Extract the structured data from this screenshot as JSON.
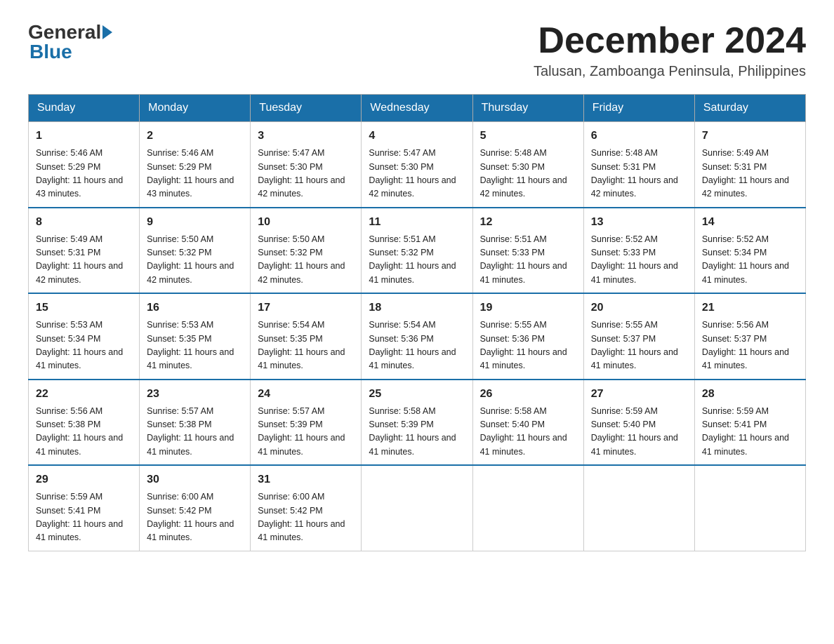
{
  "header": {
    "logo_general": "General",
    "logo_blue": "Blue",
    "month_title": "December 2024",
    "subtitle": "Talusan, Zamboanga Peninsula, Philippines"
  },
  "weekdays": [
    "Sunday",
    "Monday",
    "Tuesday",
    "Wednesday",
    "Thursday",
    "Friday",
    "Saturday"
  ],
  "weeks": [
    [
      {
        "day": "1",
        "sunrise": "5:46 AM",
        "sunset": "5:29 PM",
        "daylight": "11 hours and 43 minutes."
      },
      {
        "day": "2",
        "sunrise": "5:46 AM",
        "sunset": "5:29 PM",
        "daylight": "11 hours and 43 minutes."
      },
      {
        "day": "3",
        "sunrise": "5:47 AM",
        "sunset": "5:30 PM",
        "daylight": "11 hours and 42 minutes."
      },
      {
        "day": "4",
        "sunrise": "5:47 AM",
        "sunset": "5:30 PM",
        "daylight": "11 hours and 42 minutes."
      },
      {
        "day": "5",
        "sunrise": "5:48 AM",
        "sunset": "5:30 PM",
        "daylight": "11 hours and 42 minutes."
      },
      {
        "day": "6",
        "sunrise": "5:48 AM",
        "sunset": "5:31 PM",
        "daylight": "11 hours and 42 minutes."
      },
      {
        "day": "7",
        "sunrise": "5:49 AM",
        "sunset": "5:31 PM",
        "daylight": "11 hours and 42 minutes."
      }
    ],
    [
      {
        "day": "8",
        "sunrise": "5:49 AM",
        "sunset": "5:31 PM",
        "daylight": "11 hours and 42 minutes."
      },
      {
        "day": "9",
        "sunrise": "5:50 AM",
        "sunset": "5:32 PM",
        "daylight": "11 hours and 42 minutes."
      },
      {
        "day": "10",
        "sunrise": "5:50 AM",
        "sunset": "5:32 PM",
        "daylight": "11 hours and 42 minutes."
      },
      {
        "day": "11",
        "sunrise": "5:51 AM",
        "sunset": "5:32 PM",
        "daylight": "11 hours and 41 minutes."
      },
      {
        "day": "12",
        "sunrise": "5:51 AM",
        "sunset": "5:33 PM",
        "daylight": "11 hours and 41 minutes."
      },
      {
        "day": "13",
        "sunrise": "5:52 AM",
        "sunset": "5:33 PM",
        "daylight": "11 hours and 41 minutes."
      },
      {
        "day": "14",
        "sunrise": "5:52 AM",
        "sunset": "5:34 PM",
        "daylight": "11 hours and 41 minutes."
      }
    ],
    [
      {
        "day": "15",
        "sunrise": "5:53 AM",
        "sunset": "5:34 PM",
        "daylight": "11 hours and 41 minutes."
      },
      {
        "day": "16",
        "sunrise": "5:53 AM",
        "sunset": "5:35 PM",
        "daylight": "11 hours and 41 minutes."
      },
      {
        "day": "17",
        "sunrise": "5:54 AM",
        "sunset": "5:35 PM",
        "daylight": "11 hours and 41 minutes."
      },
      {
        "day": "18",
        "sunrise": "5:54 AM",
        "sunset": "5:36 PM",
        "daylight": "11 hours and 41 minutes."
      },
      {
        "day": "19",
        "sunrise": "5:55 AM",
        "sunset": "5:36 PM",
        "daylight": "11 hours and 41 minutes."
      },
      {
        "day": "20",
        "sunrise": "5:55 AM",
        "sunset": "5:37 PM",
        "daylight": "11 hours and 41 minutes."
      },
      {
        "day": "21",
        "sunrise": "5:56 AM",
        "sunset": "5:37 PM",
        "daylight": "11 hours and 41 minutes."
      }
    ],
    [
      {
        "day": "22",
        "sunrise": "5:56 AM",
        "sunset": "5:38 PM",
        "daylight": "11 hours and 41 minutes."
      },
      {
        "day": "23",
        "sunrise": "5:57 AM",
        "sunset": "5:38 PM",
        "daylight": "11 hours and 41 minutes."
      },
      {
        "day": "24",
        "sunrise": "5:57 AM",
        "sunset": "5:39 PM",
        "daylight": "11 hours and 41 minutes."
      },
      {
        "day": "25",
        "sunrise": "5:58 AM",
        "sunset": "5:39 PM",
        "daylight": "11 hours and 41 minutes."
      },
      {
        "day": "26",
        "sunrise": "5:58 AM",
        "sunset": "5:40 PM",
        "daylight": "11 hours and 41 minutes."
      },
      {
        "day": "27",
        "sunrise": "5:59 AM",
        "sunset": "5:40 PM",
        "daylight": "11 hours and 41 minutes."
      },
      {
        "day": "28",
        "sunrise": "5:59 AM",
        "sunset": "5:41 PM",
        "daylight": "11 hours and 41 minutes."
      }
    ],
    [
      {
        "day": "29",
        "sunrise": "5:59 AM",
        "sunset": "5:41 PM",
        "daylight": "11 hours and 41 minutes."
      },
      {
        "day": "30",
        "sunrise": "6:00 AM",
        "sunset": "5:42 PM",
        "daylight": "11 hours and 41 minutes."
      },
      {
        "day": "31",
        "sunrise": "6:00 AM",
        "sunset": "5:42 PM",
        "daylight": "11 hours and 41 minutes."
      },
      null,
      null,
      null,
      null
    ]
  ]
}
